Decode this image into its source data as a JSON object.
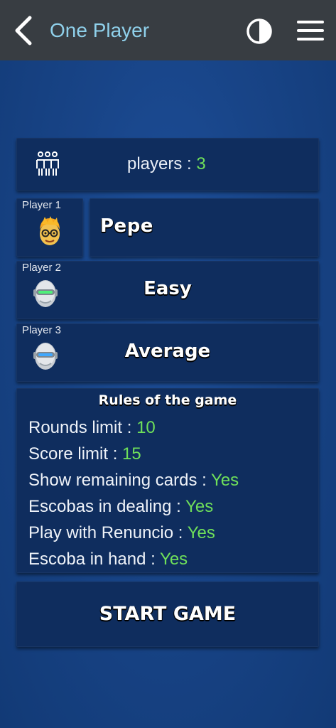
{
  "header": {
    "title": "One Player",
    "back_icon": "chevron-left-icon",
    "contrast_icon": "contrast-icon",
    "menu_icon": "hamburger-menu-icon"
  },
  "players": {
    "label": "players : ",
    "count": "3",
    "icon": "group-icon"
  },
  "player_slots": [
    {
      "label": "Player 1",
      "name": "Pepe",
      "avatar": "human-avatar-icon"
    },
    {
      "label": "Player 2",
      "name": "Easy",
      "avatar": "robot-easy-icon"
    },
    {
      "label": "Player 3",
      "name": "Average",
      "avatar": "robot-average-icon"
    }
  ],
  "rules": {
    "title": "Rules of the game",
    "items": [
      {
        "label": "Rounds limit : ",
        "value": "10"
      },
      {
        "label": "Score limit : ",
        "value": "15"
      },
      {
        "label": "Show remaining cards : ",
        "value": "Yes"
      },
      {
        "label": "Escobas in dealing : ",
        "value": "Yes"
      },
      {
        "label": "Play with Renuncio : ",
        "value": "Yes"
      },
      {
        "label": "Escoba in hand : ",
        "value": "Yes"
      }
    ]
  },
  "start_button": {
    "label": "START GAME"
  },
  "colors": {
    "accent_value": "#6fe05a",
    "title": "#8fd0ea",
    "topbar": "#383d42",
    "panel": "#0f2d5e"
  }
}
